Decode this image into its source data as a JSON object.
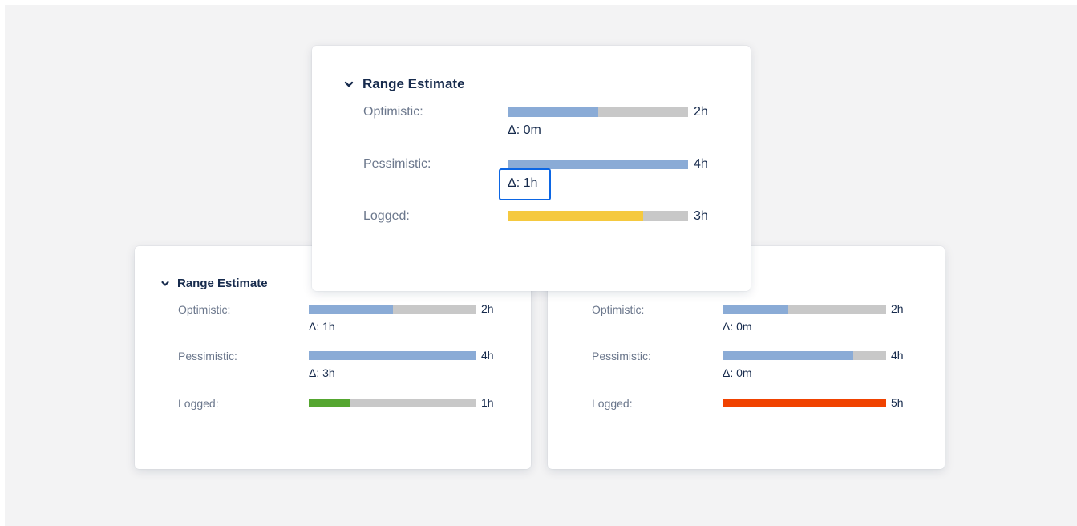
{
  "colors": {
    "estimate_fill": "#8aabd6",
    "track": "#c8c8c8",
    "logged_warning": "#f5c93f",
    "logged_ok": "#55a630",
    "logged_over": "#f04200",
    "focus": "#0c66e4"
  },
  "cards": {
    "top": {
      "title": "Range Estimate",
      "chevron_icon": "chevron-down-icon",
      "optimistic": {
        "label": "Optimistic:",
        "value": "2h",
        "delta": "Δ: 0m",
        "fill_percent": 50
      },
      "pessimistic": {
        "label": "Pessimistic:",
        "value": "4h",
        "delta": "Δ: 1h",
        "fill_percent": 100
      },
      "logged": {
        "label": "Logged:",
        "value": "3h",
        "fill_percent": 75
      }
    },
    "bottom_left": {
      "title": "Range Estimate",
      "chevron_icon": "chevron-down-icon",
      "optimistic": {
        "label": "Optimistic:",
        "value": "2h",
        "delta": "Δ: 1h",
        "fill_percent": 50
      },
      "pessimistic": {
        "label": "Pessimistic:",
        "value": "4h",
        "delta": "Δ: 3h",
        "fill_percent": 100
      },
      "logged": {
        "label": "Logged:",
        "value": "1h",
        "fill_percent": 25
      }
    },
    "bottom_right": {
      "optimistic": {
        "label": "Optimistic:",
        "value": "2h",
        "delta": "Δ: 0m",
        "fill_percent": 40
      },
      "pessimistic": {
        "label": "Pessimistic:",
        "value": "4h",
        "delta": "Δ: 0m",
        "fill_percent": 80
      },
      "logged": {
        "label": "Logged:",
        "value": "5h",
        "fill_percent": 100
      }
    }
  }
}
